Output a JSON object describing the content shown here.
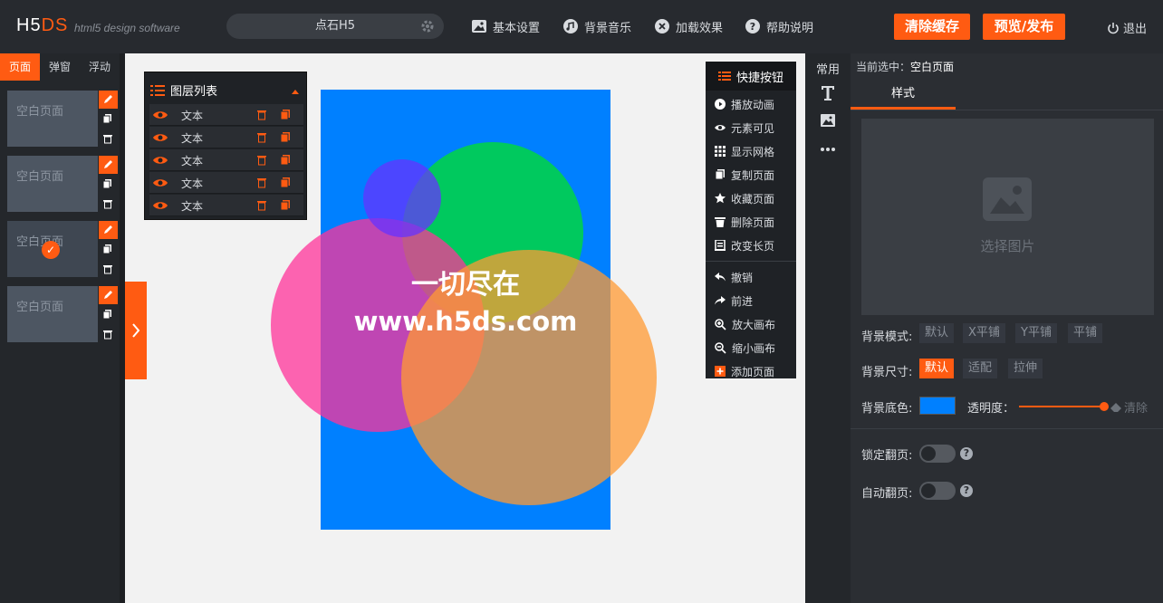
{
  "header": {
    "logo_h5": "H5",
    "logo_ds": "DS",
    "logo_subtitle": "html5 design software",
    "project_title": "点石H5",
    "menu": [
      "基本设置",
      "背景音乐",
      "加载效果",
      "帮助说明"
    ],
    "clear_cache_label": "清除缓存",
    "publish_label": "预览/发布",
    "logout_label": "退出"
  },
  "left_panel": {
    "tabs": [
      "页面",
      "弹窗",
      "浮动"
    ],
    "active_tab": "页面",
    "pages": [
      {
        "label": "空白页面",
        "selected": false
      },
      {
        "label": "空白页面",
        "selected": false
      },
      {
        "label": "空白页面",
        "selected": true
      },
      {
        "label": "空白页面",
        "selected": false
      }
    ]
  },
  "layers": {
    "title": "图层列表",
    "items": [
      "文本",
      "文本",
      "文本",
      "文本",
      "文本"
    ]
  },
  "quick_buttons": {
    "title": "快捷按钮",
    "group1": [
      "播放动画",
      "元素可见",
      "显示网格",
      "复制页面",
      "收藏页面",
      "删除页面",
      "改变长页"
    ],
    "group2": [
      "撤销",
      "前进",
      "放大画布",
      "缩小画布",
      "添加页面"
    ]
  },
  "canvas": {
    "line1": "一切尽在",
    "line2": "www.h5ds.com",
    "background": "#0080ff"
  },
  "tools": {
    "label": "常用"
  },
  "properties": {
    "current_prefix": "当前选中：",
    "current_name": "空白页面",
    "tab": "样式",
    "choose_image": "选择图片",
    "bg_mode_label": "背景模式:",
    "bg_modes": [
      "默认",
      "X平铺",
      "Y平铺",
      "平铺"
    ],
    "bg_size_label": "背景尺寸:",
    "bg_sizes": [
      "默认",
      "适配",
      "拉伸"
    ],
    "bg_color_label": "背景底色:",
    "bg_color": "#0080ff",
    "opacity_label": "透明度：",
    "clear_label": "清除",
    "lock_label": "锁定翻页:",
    "auto_label": "自动翻页:",
    "help": "?"
  },
  "colors": {
    "accent": "#ff5b12"
  }
}
